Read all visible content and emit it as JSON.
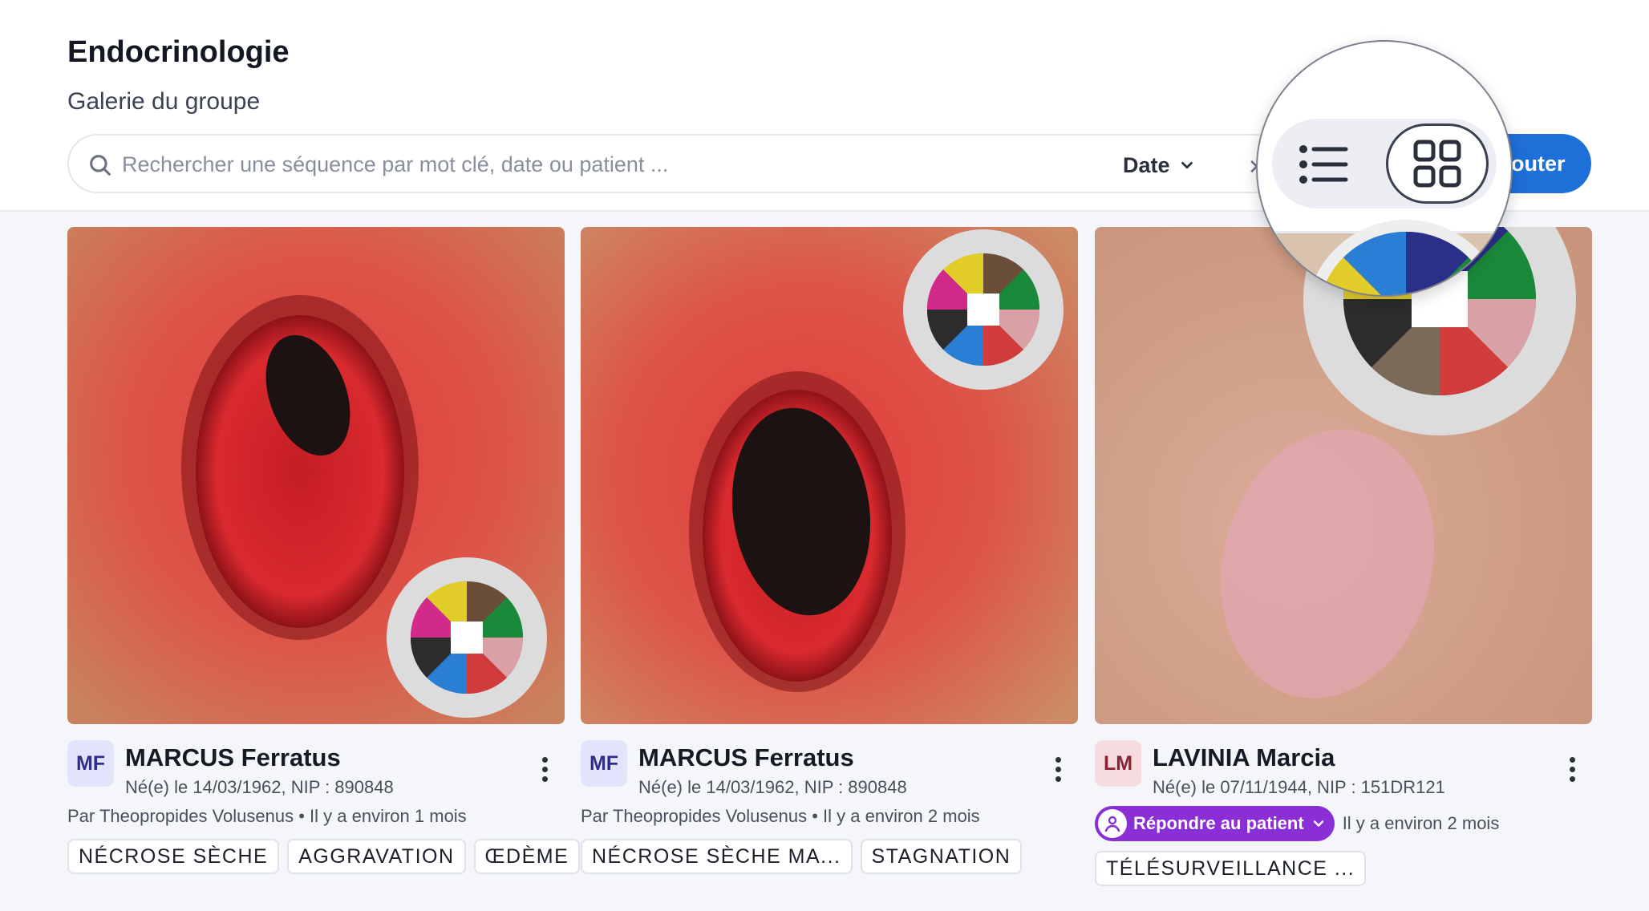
{
  "header": {
    "title": "Endocrinologie",
    "subtitle": "Galerie du groupe",
    "search_placeholder": "Rechercher une séquence par mot clé, date ou patient ...",
    "sort_label": "Date",
    "add_label": "outer"
  },
  "view_toggle": {
    "options": [
      "list-icon",
      "grid-icon"
    ],
    "selected": "grid"
  },
  "cards": [
    {
      "initials": "MF",
      "name": "MARCUS Ferratus",
      "info": "Né(e) le 14/03/1962, NIP : 890848",
      "author": "Par Theopropides Volusenus • Il y a environ 1 mois",
      "tags": [
        "NÉCROSE SÈCHE",
        "AGGRAVATION",
        "ŒDÈME"
      ]
    },
    {
      "initials": "MF",
      "name": "MARCUS Ferratus",
      "info": "Né(e) le 14/03/1962, NIP : 890848",
      "author": "Par Theopropides Volusenus • Il y a environ 2 mois",
      "tags": [
        "NÉCROSE SÈCHE MA...",
        "STAGNATION"
      ]
    },
    {
      "initials": "LM",
      "name": "LAVINIA Marcia",
      "info": "Né(e) le 07/11/1944, NIP : 151DR121",
      "reply_label": "Répondre au patient",
      "time": "Il y a environ 2 mois",
      "tags": [
        "TÉLÉSURVEILLANCE ..."
      ]
    }
  ],
  "colors": {
    "accent": "#1f6fd8",
    "reply_purple": "#8a2fd6",
    "avatar_mf_bg": "#e3e4fb",
    "avatar_lm_bg": "#f6dbdf"
  }
}
